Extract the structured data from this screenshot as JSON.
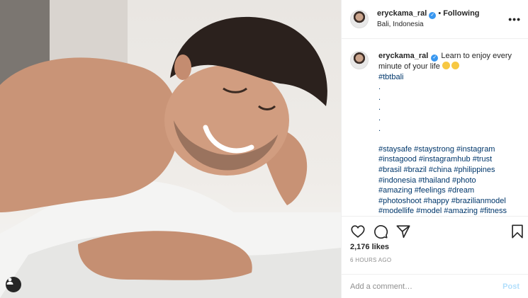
{
  "post": {
    "author": {
      "username": "eryckama_ral",
      "verified": true,
      "following_label": "Following",
      "location": "Bali, Indonesia"
    },
    "caption": {
      "username": "eryckama_ral",
      "text": "Learn to enjoy every minute of your life",
      "emojis": [
        "smile-emoji",
        "grin-emoji"
      ],
      "first_tag": "#tbtbali",
      "dots": [
        ".",
        ".",
        ".",
        ".",
        "."
      ],
      "hashtag_lines": [
        "#staysafe #staystrong #instagram",
        "#instagood #instagramhub #trust",
        "#brasil #brazil #china #philippines",
        "#indonesia #thailand #photo",
        "#amazing #feelings #dream",
        "#photoshoot #happy #brazilianmodel",
        "#modellife #model #amazing #fitness"
      ]
    },
    "likes": "2,176 likes",
    "time": "6 HOURS AGO",
    "comment": {
      "placeholder": "Add a comment…",
      "post_label": "Post"
    },
    "colors": {
      "hashtag": "#00376b",
      "verified": "#3897f0",
      "post_disabled": "#b2dffc",
      "muted": "#8e8e8e"
    },
    "icons": {
      "more": "more-horizontal-icon",
      "like": "heart-icon",
      "comment": "comment-bubble-icon",
      "share": "paper-plane-icon",
      "save": "bookmark-icon",
      "tag": "user-tag-icon"
    }
  }
}
